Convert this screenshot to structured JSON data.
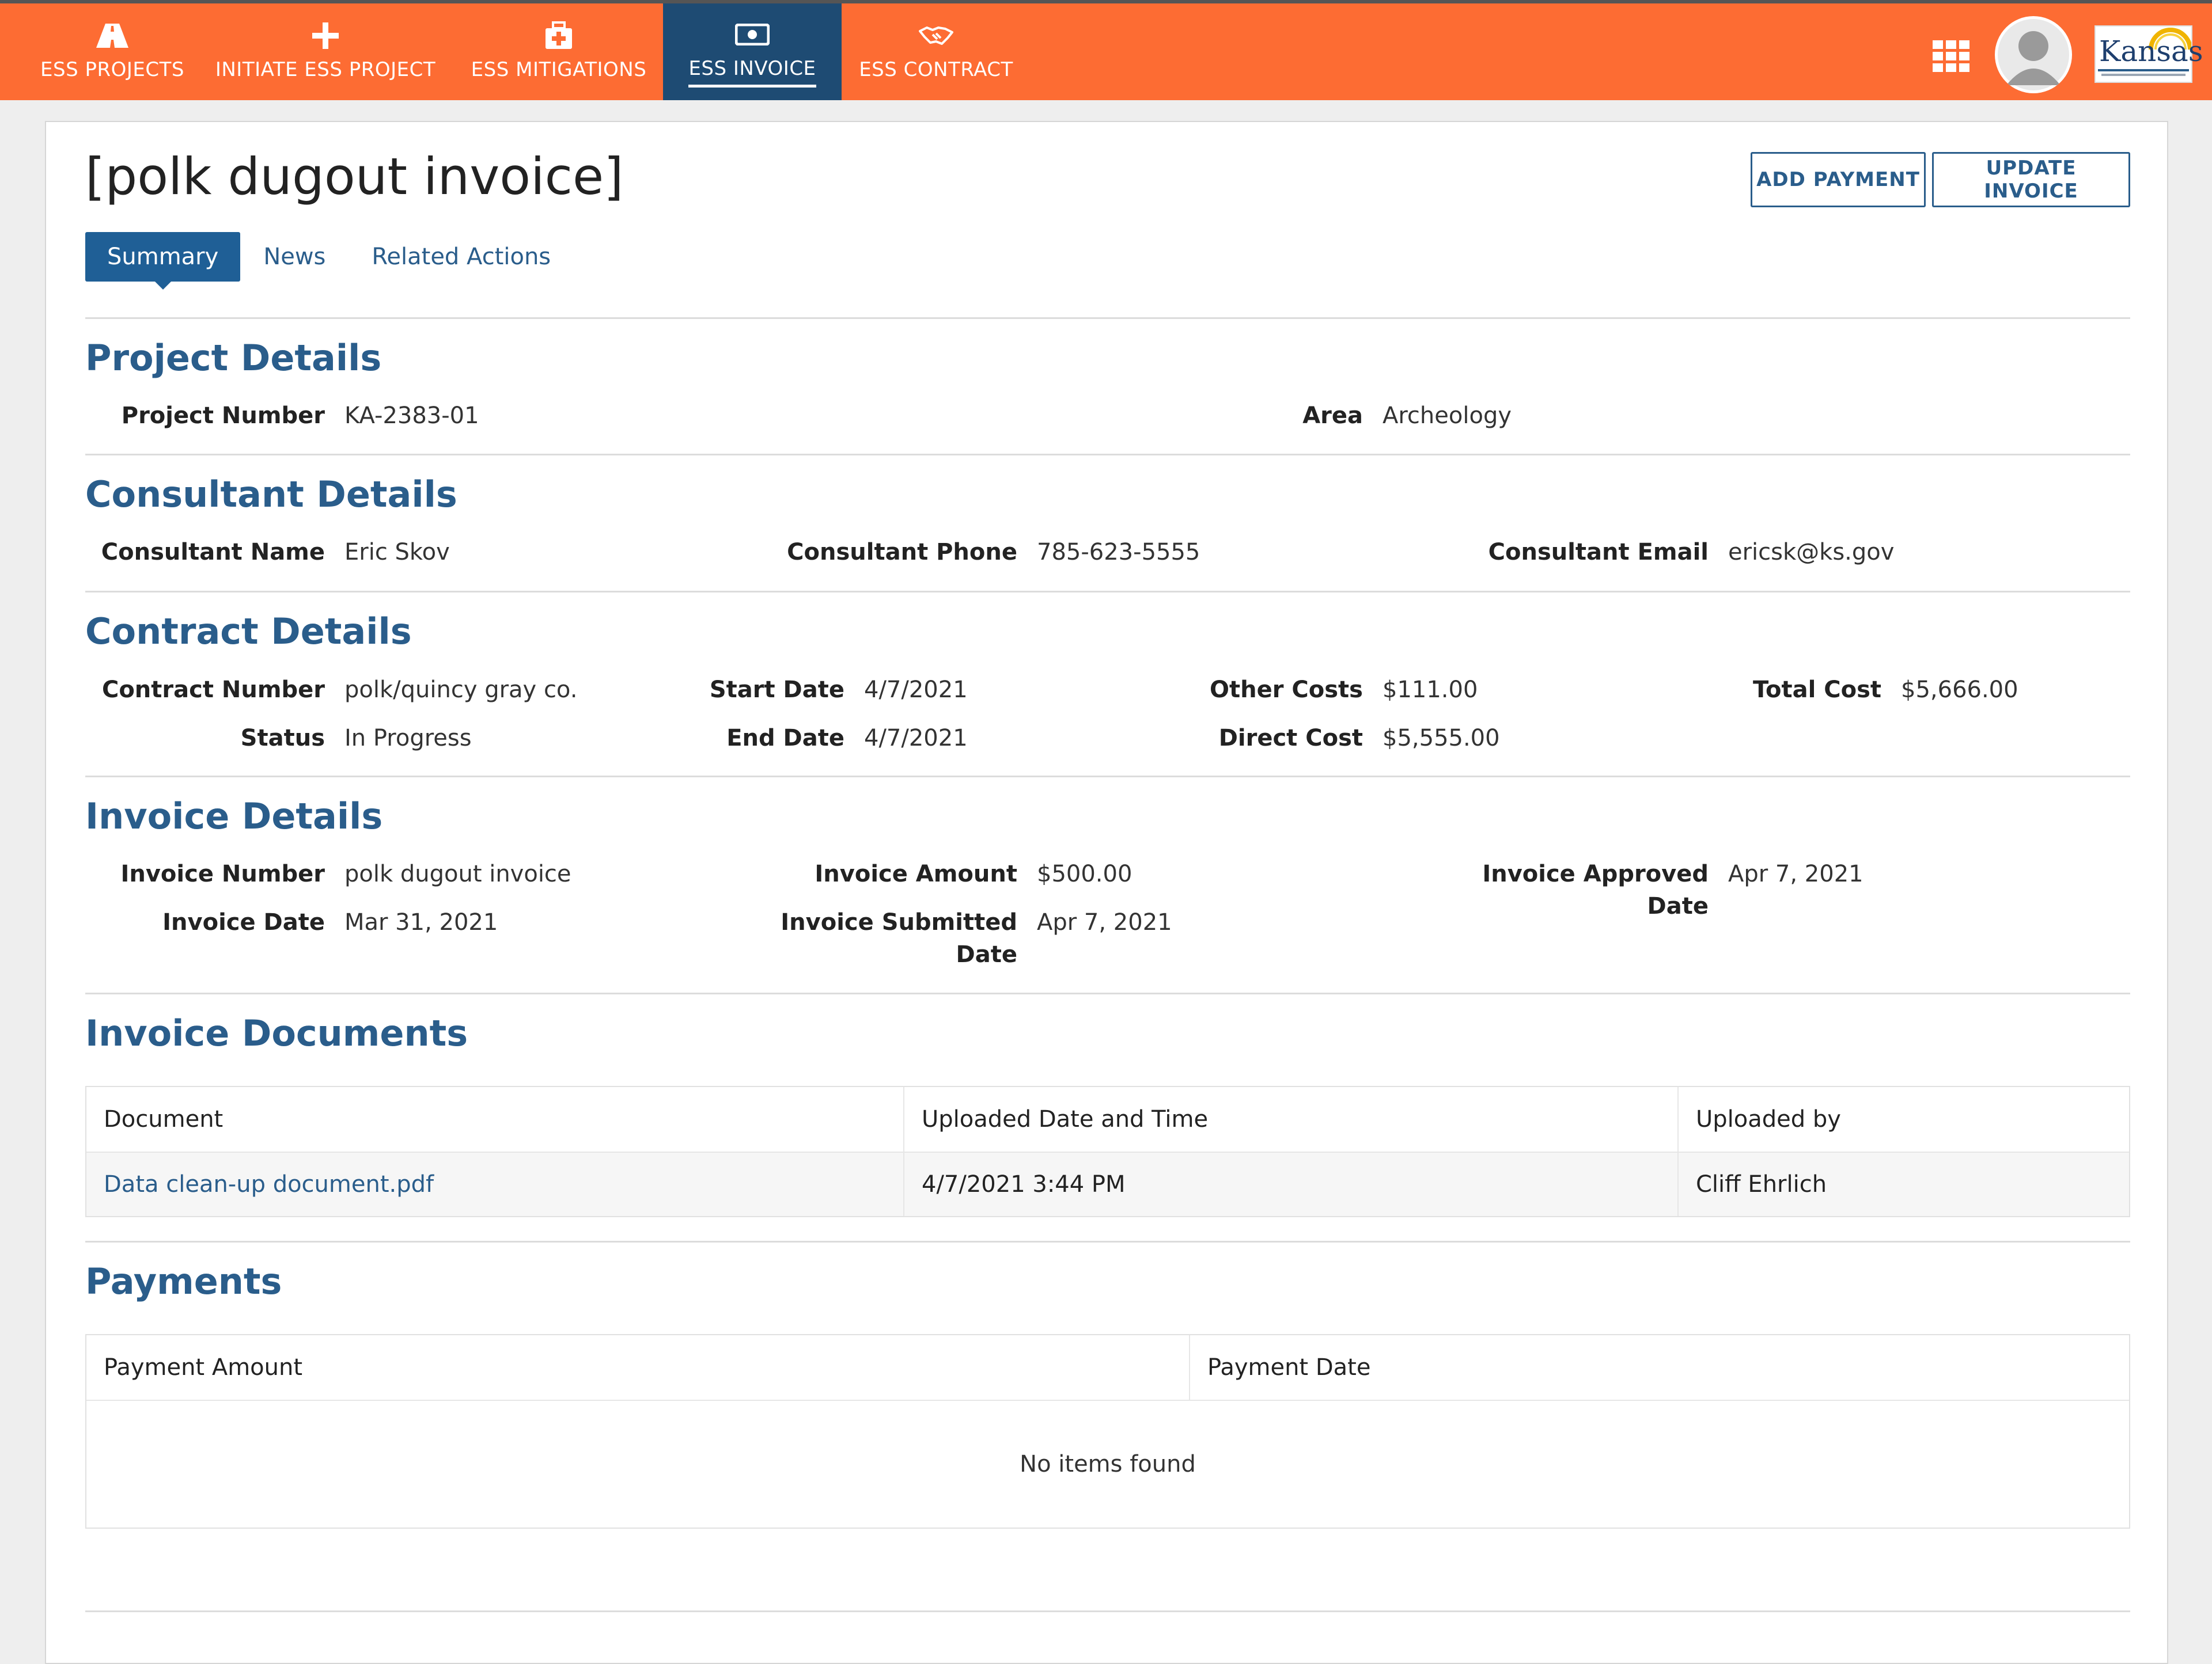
{
  "nav": {
    "items": [
      {
        "label": "ESS PROJECTS",
        "icon": "road-icon"
      },
      {
        "label": "INITIATE ESS PROJECT",
        "icon": "plus-icon"
      },
      {
        "label": "ESS MITIGATIONS",
        "icon": "medical-kit-icon"
      },
      {
        "label": "ESS INVOICE",
        "icon": "money-bill-icon",
        "active": true
      },
      {
        "label": "ESS CONTRACT",
        "icon": "handshake-icon"
      }
    ],
    "apps_icon": "grid-apps-icon",
    "avatar_icon": "user-avatar-icon",
    "logo_text": "Kansas"
  },
  "page": {
    "title": "[polk dugout invoice]",
    "add_payment": "ADD PAYMENT",
    "update_invoice": "UPDATE INVOICE"
  },
  "tabs": [
    "Summary",
    "News",
    "Related Actions"
  ],
  "project": {
    "heading": "Project Details",
    "number_label": "Project Number",
    "number": "KA-2383-01",
    "area_label": "Area",
    "area": "Archeology"
  },
  "consultant": {
    "heading": "Consultant Details",
    "name_label": "Consultant Name",
    "name": "Eric Skov",
    "phone_label": "Consultant Phone",
    "phone": "785-623-5555",
    "email_label": "Consultant Email",
    "email": "ericsk@ks.gov"
  },
  "contract": {
    "heading": "Contract Details",
    "number_label": "Contract Number",
    "number": "polk/quincy gray co.",
    "status_label": "Status",
    "status": "In Progress",
    "start_label": "Start Date",
    "start": "4/7/2021",
    "end_label": "End Date",
    "end": "4/7/2021",
    "other_label": "Other Costs",
    "other": "$111.00",
    "direct_label": "Direct Cost",
    "direct": "$5,555.00",
    "total_label": "Total Cost",
    "total": "$5,666.00"
  },
  "invoice": {
    "heading": "Invoice Details",
    "number_label": "Invoice Number",
    "number": "polk dugout invoice",
    "date_label": "Invoice Date",
    "date": "Mar 31, 2021",
    "amount_label": "Invoice Amount",
    "amount": "$500.00",
    "submitted_label_1": "Invoice Submitted",
    "submitted_label_2": "Date",
    "submitted": "Apr 7, 2021",
    "approved_label_1": "Invoice Approved",
    "approved_label_2": "Date",
    "approved": "Apr 7, 2021"
  },
  "documents": {
    "heading": "Invoice Documents",
    "columns": [
      "Document",
      "Uploaded Date and Time",
      "Uploaded by"
    ],
    "rows": [
      {
        "document": "Data clean-up document.pdf",
        "uploaded": "4/7/2021 3:44 PM",
        "by": "Cliff Ehrlich"
      }
    ]
  },
  "payments": {
    "heading": "Payments",
    "columns": [
      "Payment Amount",
      "Payment Date"
    ],
    "empty": "No items found"
  },
  "colors": {
    "nav_bg": "#fd6c33",
    "nav_active": "#1e4b73",
    "accent": "#2a5d8b"
  }
}
